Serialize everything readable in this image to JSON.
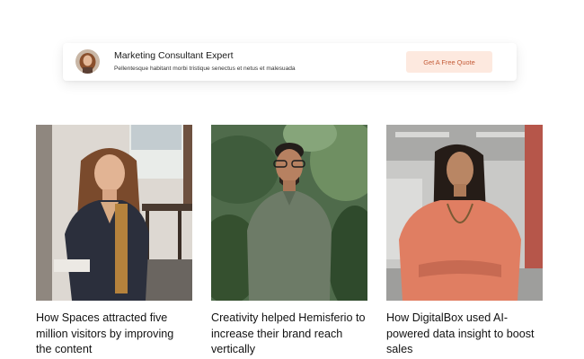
{
  "consultant_card": {
    "title": "Marketing Consultant Expert",
    "subtitle": "Pellentesque habitant morbi tristique senectus et netus et malesuada",
    "button_label": "Get A Free Quote",
    "avatar_icon": "person-avatar"
  },
  "articles": [
    {
      "title": "How Spaces attracted five million visitors by improving the content",
      "image": "woman-in-blazer-photo"
    },
    {
      "title": "Creativity helped Hemisferio to increase their brand reach vertically",
      "image": "man-in-green-polo-photo"
    },
    {
      "title": "How DigitalBox used AI-powered data insight to boost sales",
      "image": "woman-in-coral-sweater-photo"
    }
  ],
  "colors": {
    "button_bg": "#fde9df",
    "button_text": "#c45c38",
    "text": "#161616"
  }
}
